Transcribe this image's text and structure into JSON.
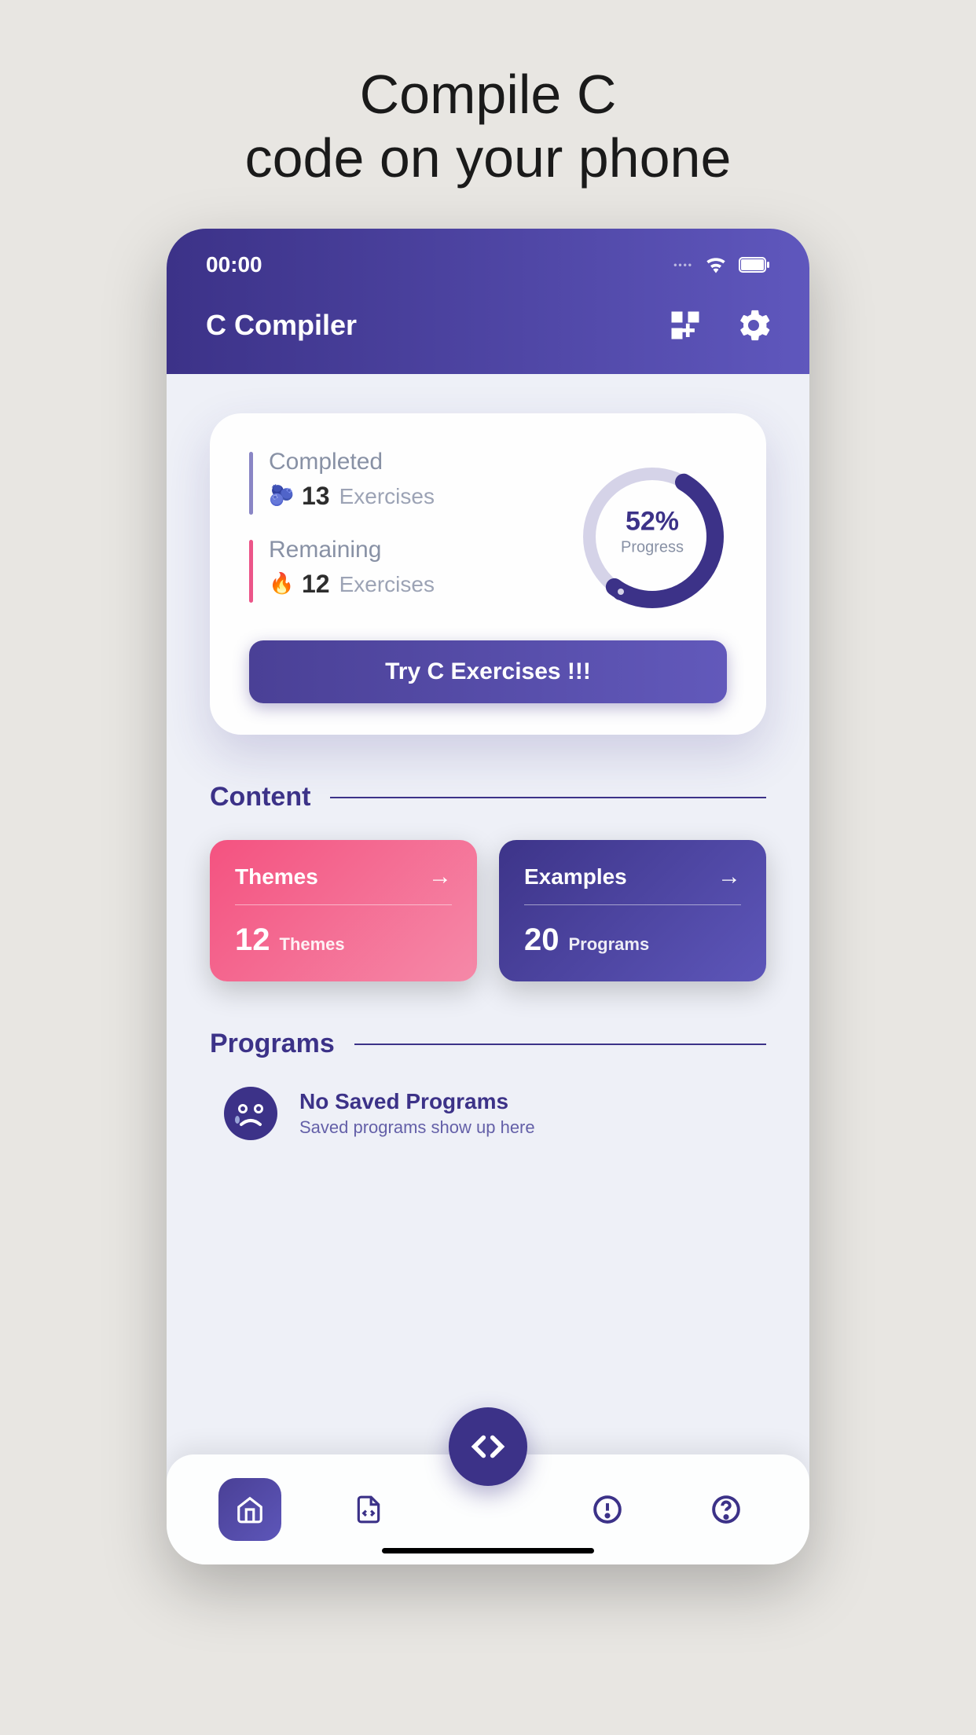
{
  "promo": {
    "line1": "Compile C",
    "line2": "code on your phone"
  },
  "status": {
    "time": "00:00"
  },
  "header": {
    "title": "C Compiler"
  },
  "progress": {
    "completed": {
      "label": "Completed",
      "num": "13",
      "unit": "Exercises"
    },
    "remaining": {
      "label": "Remaining",
      "num": "12",
      "unit": "Exercises"
    },
    "ring": {
      "percent": "52%",
      "label": "Progress"
    },
    "cta": "Try C Exercises !!!"
  },
  "sections": {
    "content": "Content",
    "programs": "Programs"
  },
  "tiles": {
    "themes": {
      "title": "Themes",
      "num": "12",
      "unit": "Themes"
    },
    "examples": {
      "title": "Examples",
      "num": "20",
      "unit": "Programs"
    }
  },
  "empty": {
    "title": "No Saved Programs",
    "sub": "Saved programs show up here"
  }
}
